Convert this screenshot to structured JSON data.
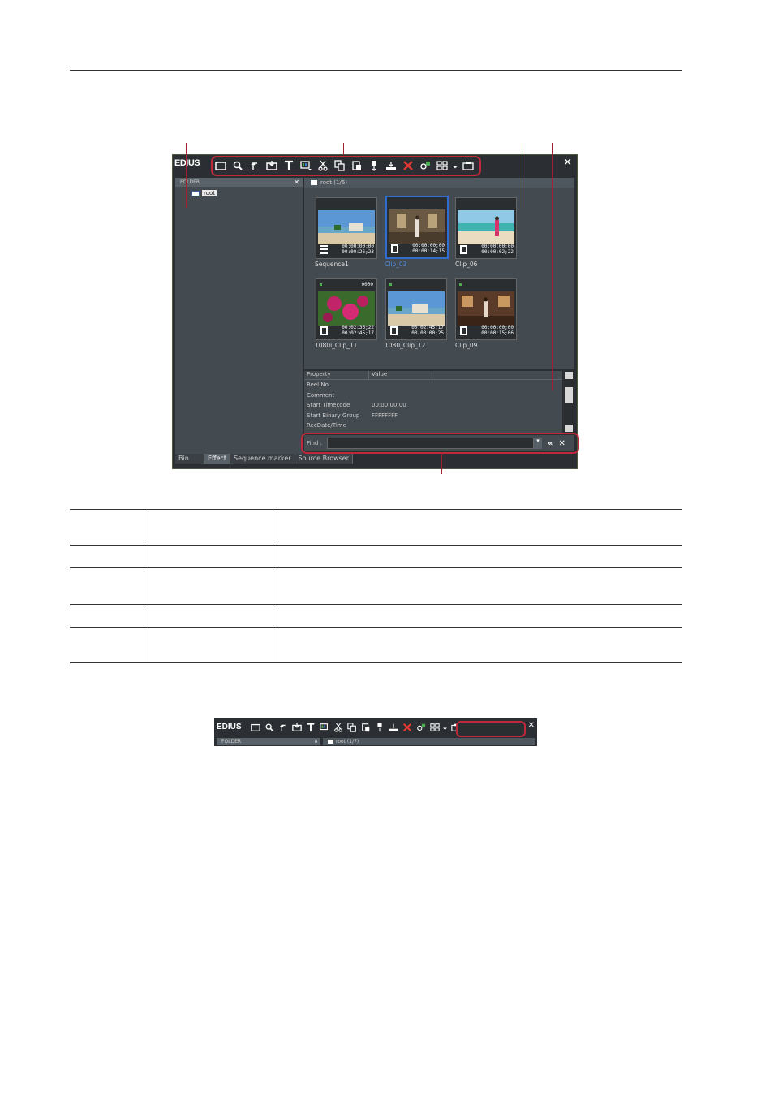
{
  "window": {
    "title": "EDIUS",
    "close": "✕",
    "folder_header": "FOLDER",
    "folder_close": "✕",
    "tree_root": "root",
    "clip_header": "root (1/6)",
    "clips": [
      {
        "label": "Sequence1",
        "tc_top": "00:00:00;00",
        "tc_bottom": "00:00:26;23",
        "icon": "sequence-icon",
        "selected": false
      },
      {
        "label": "Clip_03",
        "tc_top": "00:00:00;00",
        "tc_bottom": "00:00:14;15",
        "icon": "film-icon",
        "selected": true
      },
      {
        "label": "Clip_06",
        "tc_top": "00:00:00;00",
        "tc_bottom": "00:00:02;22",
        "icon": "film-icon",
        "selected": false
      },
      {
        "label": "1080i_Clip_11",
        "tc_top": "00:02:36;22",
        "tc_bottom": "00:02:45;17",
        "icon": "film-icon",
        "selected": false,
        "num": "0000"
      },
      {
        "label": "1080_Clip_12",
        "tc_top": "00:02:45;17",
        "tc_bottom": "00:03:00;25",
        "icon": "film-icon",
        "selected": false
      },
      {
        "label": "Clip_09",
        "tc_top": "00:00:00;00",
        "tc_bottom": "00:00:15;06",
        "icon": "film-icon",
        "selected": false
      }
    ],
    "properties": {
      "col_property": "Property",
      "col_value": "Value",
      "rows": [
        {
          "key": "Reel No",
          "value": ""
        },
        {
          "key": "Comment",
          "value": ""
        },
        {
          "key": "Start Timecode",
          "value": "00:00:00;00"
        },
        {
          "key": "Start Binary Group",
          "value": "FFFFFFFF"
        },
        {
          "key": "RecDate/Time",
          "value": ""
        }
      ]
    },
    "find": {
      "label": "Find :",
      "value": "",
      "dropdown": "▾",
      "collapse": "«",
      "close": "✕"
    },
    "tabs": [
      "Bin",
      "Effect",
      "Sequence marker",
      "Source Browser"
    ],
    "active_tab": "Effect"
  },
  "mini": {
    "title": "EDIUS",
    "close": "✕",
    "folder_header": "FOLDER",
    "folder_close": "✕",
    "clip_header": "root (1/7)"
  },
  "colors": {
    "highlight": "#c0283c",
    "selected": "#2f6dd3"
  }
}
